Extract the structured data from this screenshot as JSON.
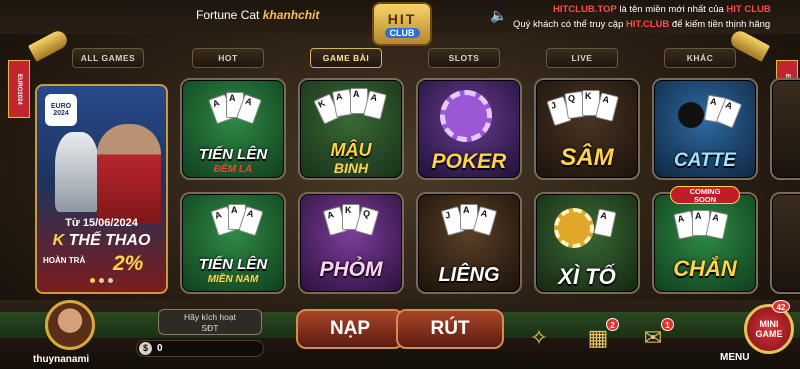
{
  "header": {
    "welcome_game": "Fortune Cat",
    "welcome_user": "khanhchit",
    "logo_top": "HIT",
    "logo_bottom": "CLUB",
    "marquee_line1_prefix": "HITCLUB.TOP",
    "marquee_line1_rest": " là tên miền mới nhất của ",
    "marquee_line1_brand": "HIT CLUB",
    "marquee_line2_prefix": "Quý khách có thể truy cập ",
    "marquee_line2_brand": "HIT.CLUB",
    "marquee_line2_rest": " để kiếm tiền thịnh hãng"
  },
  "tabs": [
    {
      "label": "ALL GAMES"
    },
    {
      "label": "HOT"
    },
    {
      "label": "GAME BÀI"
    },
    {
      "label": "SLOTS"
    },
    {
      "label": "LIVE"
    },
    {
      "label": "KHÁC"
    }
  ],
  "active_tab": "GAME BÀI",
  "banner": {
    "badge": "EURO 2024",
    "date": "Từ 15/06/2024",
    "title_k": "K",
    "title_rest": " THỂ THAO",
    "subtitle": "HOÀN TRẢ",
    "percent": "2%"
  },
  "side_flag": "EURO2024",
  "games": [
    {
      "name": "TIẾN LÊN",
      "sub": "ĐẾM LÁ"
    },
    {
      "name": "MẬU",
      "sub": "BINH"
    },
    {
      "name": "POKER",
      "sub": ""
    },
    {
      "name": "SÂM",
      "sub": ""
    },
    {
      "name": "CATTE",
      "sub": ""
    },
    {
      "name": "TIẾN LÊN",
      "sub": "MIỀN NAM"
    },
    {
      "name": "PHỎM",
      "sub": ""
    },
    {
      "name": "LIÊNG",
      "sub": ""
    },
    {
      "name": "XÌ TỐ",
      "sub": ""
    },
    {
      "name": "CHẮN",
      "sub": ""
    }
  ],
  "coming_soon": {
    "line1": "COMING",
    "line2": "SOON"
  },
  "bottom": {
    "username": "thuynanami",
    "activate_line1": "Hãy kích hoạt",
    "activate_line2": "SĐT",
    "currency_icon": "$",
    "balance": "0",
    "nap_label": "NẠP",
    "rut_label": "RÚT",
    "gift_badge": "2",
    "mail_badge": "1",
    "mini_badge": "42",
    "mini_line1": "MINI",
    "mini_line2": "GAME",
    "menu_label": "MENU"
  },
  "colors": {
    "accent_gold": "#ffd34d",
    "danger_red": "#ff4b4b",
    "brown_button": "#a9452a"
  }
}
